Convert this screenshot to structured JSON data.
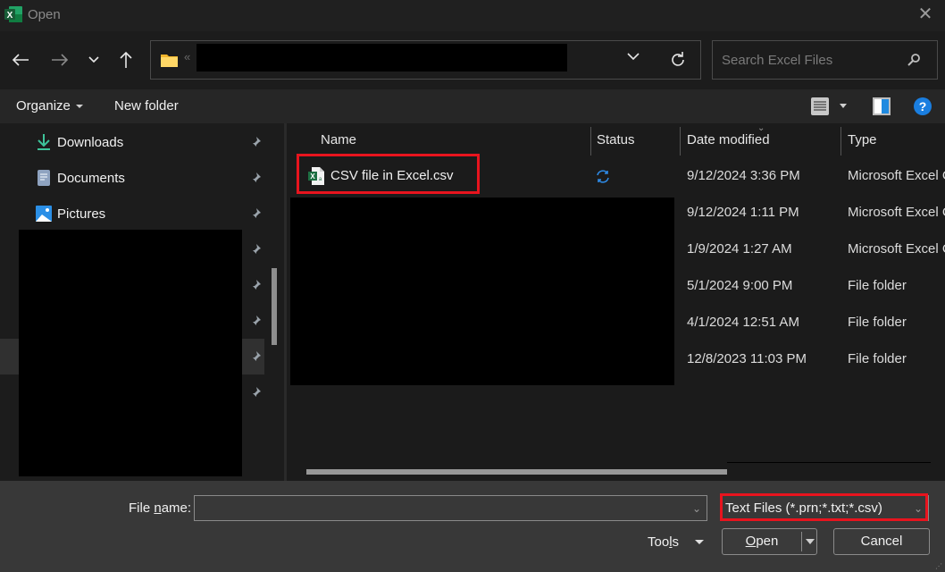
{
  "window": {
    "title": "Open",
    "close_glyph": "✕"
  },
  "nav": {
    "back_glyph": "←",
    "forward_glyph": "→",
    "recent_glyph": "⌄",
    "up_glyph": "↑",
    "address_prefix": "«",
    "search_placeholder": "Search Excel Files"
  },
  "commands": {
    "organize": "Organize",
    "new_folder": "New folder",
    "help_glyph": "?"
  },
  "sidebar": {
    "items": [
      {
        "label": "Downloads",
        "icon": "download-icon"
      },
      {
        "label": "Documents",
        "icon": "document-icon"
      },
      {
        "label": "Pictures",
        "icon": "pictures-icon"
      }
    ]
  },
  "filelist": {
    "columns": {
      "name": "Name",
      "status": "Status",
      "date": "Date modified",
      "type": "Type"
    },
    "sort_glyph": "⌄",
    "rows": [
      {
        "name": "CSV file in Excel.csv",
        "status": "sync-icon",
        "date": "9/12/2024 3:36 PM",
        "type": "Microsoft Excel C"
      },
      {
        "name": "",
        "date": "9/12/2024 1:11 PM",
        "type": "Microsoft Excel C"
      },
      {
        "name": "",
        "date": "1/9/2024 1:27 AM",
        "type": "Microsoft Excel C"
      },
      {
        "name": "",
        "date": "5/1/2024 9:00 PM",
        "type": "File folder"
      },
      {
        "name": "",
        "date": "4/1/2024 12:51 AM",
        "type": "File folder"
      },
      {
        "name": "",
        "date": "12/8/2023 11:03 PM",
        "type": "File folder"
      }
    ]
  },
  "footer": {
    "filename_label_pre": "File ",
    "filename_label_accel": "n",
    "filename_label_post": "ame:",
    "filename_value": "",
    "filetype_value": "Text Files (*.prn;*.txt;*.csv)",
    "tools_pre": "Too",
    "tools_accel": "l",
    "tools_post": "s",
    "open_accel": "O",
    "open_post": "pen",
    "cancel": "Cancel",
    "dd_glyph": "⌄"
  },
  "colors": {
    "highlight": "#e8141e",
    "accent": "#1a7ee0",
    "excel_green": "#1d6f42"
  }
}
